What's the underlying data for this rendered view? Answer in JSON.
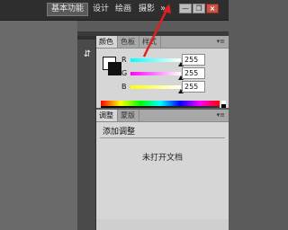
{
  "topbar": {
    "workspaces": [
      {
        "label": "基本功能",
        "active": true
      },
      {
        "label": "设计",
        "active": false
      },
      {
        "label": "绘画",
        "active": false
      },
      {
        "label": "摄影",
        "active": false
      }
    ],
    "more_icon": "double-chevron-right-icon",
    "more_glyph": "»",
    "window_buttons": {
      "minimize": "minimize-icon",
      "restore": "restore-icon",
      "close": "close-icon",
      "minimize_glyph": "—",
      "restore_glyph": "❐",
      "close_glyph": "×"
    }
  },
  "dock": {
    "icon": "color-picker-icon",
    "icon_glyph": "⇵"
  },
  "color_panel": {
    "tabs": [
      {
        "label": "颜色",
        "active": true
      },
      {
        "label": "色板",
        "active": false
      },
      {
        "label": "样式",
        "active": false
      }
    ],
    "menu_glyph": "▾≡",
    "swatch": {
      "foreground": "#111111",
      "background": "#ffffff"
    },
    "channels": [
      {
        "label": "R",
        "value": "255",
        "fraction": 1.0,
        "gradient": "linear-gradient(to right, #00ffff, #ffffff)"
      },
      {
        "label": "G",
        "value": "255",
        "fraction": 1.0,
        "gradient": "linear-gradient(to right, #ff00ff, #ffffff)"
      },
      {
        "label": "B",
        "value": "255",
        "fraction": 1.0,
        "gradient": "linear-gradient(to right, #ffff00, #ffffff)"
      }
    ]
  },
  "adjust_panel": {
    "tabs": [
      {
        "label": "调整",
        "active": true
      },
      {
        "label": "蒙版",
        "active": false
      }
    ],
    "menu_glyph": "▾≡",
    "title": "添加调整",
    "message": "未打开文档"
  },
  "annotation": {
    "arrow_color": "#e02020"
  }
}
